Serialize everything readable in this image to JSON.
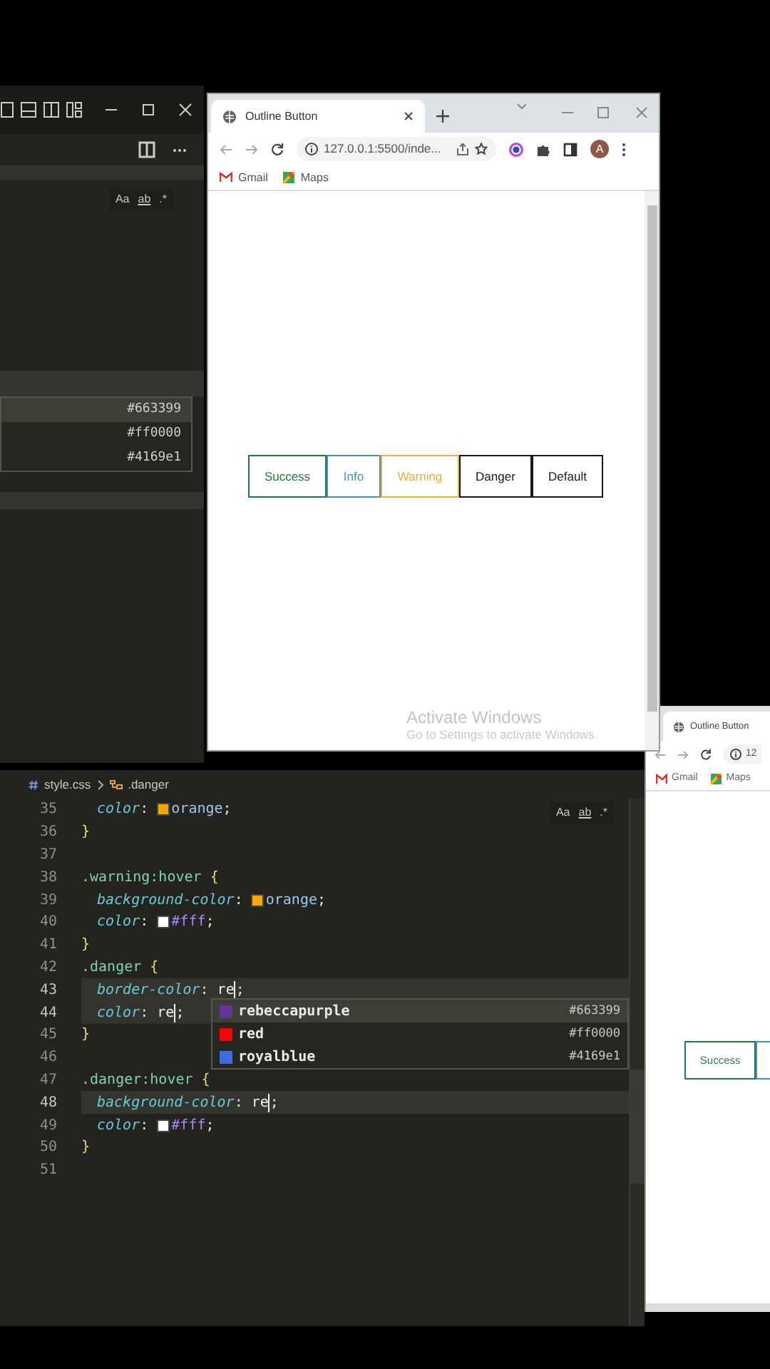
{
  "top_editor": {
    "find_toggles": [
      "Aa",
      "ab",
      ".*"
    ],
    "suggestions": [
      {
        "code": "#663399",
        "selected": true
      },
      {
        "code": "#ff0000",
        "selected": false
      },
      {
        "code": "#4169e1",
        "selected": false
      }
    ]
  },
  "browser": {
    "tab_title": "Outline Button",
    "url": "127.0.0.1:5500/inde...",
    "avatar": "A",
    "bookmarks": [
      "Gmail",
      "Maps"
    ],
    "buttons": [
      {
        "label": "Success",
        "color": "#1f7a3a"
      },
      {
        "label": "Info",
        "color": "#4a90c2"
      },
      {
        "label": "Warning",
        "color": "#f0ad3c"
      },
      {
        "label": "Danger",
        "color": "#1a1a1a"
      },
      {
        "label": "Default",
        "color": "#1a1a1a"
      }
    ],
    "activation": {
      "title": "Activate Windows",
      "subtitle": "Go to Settings to activate Windows."
    }
  },
  "editor": {
    "breadcrumb": [
      "style.css",
      ".danger"
    ],
    "find_toggles": [
      "Aa",
      "ab",
      ".*"
    ],
    "lines": [
      {
        "number": "35",
        "indented": true,
        "highlighted": false,
        "segments": [
          {
            "kind": "prop",
            "text": "color"
          },
          {
            "kind": "punct",
            "text": ": "
          },
          {
            "kind": "swatch",
            "color": "#ffa500"
          },
          {
            "kind": "value",
            "text": "orange"
          },
          {
            "kind": "punct",
            "text": ";"
          }
        ]
      },
      {
        "number": "36",
        "indented": false,
        "highlighted": false,
        "segments": [
          {
            "kind": "brace",
            "text": "}"
          }
        ]
      },
      {
        "number": "37",
        "highlighted": false
      },
      {
        "number": "38",
        "indented": false,
        "highlighted": false,
        "segments": [
          {
            "kind": "selector",
            "text": ".warning:hover"
          },
          {
            "kind": "brace",
            "text": " {"
          }
        ]
      },
      {
        "number": "39",
        "indented": true,
        "highlighted": false,
        "segments": [
          {
            "kind": "prop",
            "text": "background-color"
          },
          {
            "kind": "punct",
            "text": ": "
          },
          {
            "kind": "swatch",
            "color": "#ffa500"
          },
          {
            "kind": "value",
            "text": "orange"
          },
          {
            "kind": "punct",
            "text": ";"
          }
        ]
      },
      {
        "number": "40",
        "indented": true,
        "highlighted": false,
        "segments": [
          {
            "kind": "prop",
            "text": "color"
          },
          {
            "kind": "punct",
            "text": ": "
          },
          {
            "kind": "swatch",
            "color": "#ffffff"
          },
          {
            "kind": "hex",
            "text": "#fff"
          },
          {
            "kind": "punct",
            "text": ";"
          }
        ]
      },
      {
        "number": "41",
        "indented": false,
        "highlighted": false,
        "segments": [
          {
            "kind": "brace",
            "text": "}"
          }
        ]
      },
      {
        "number": "42",
        "indented": false,
        "highlighted": false,
        "segments": [
          {
            "kind": "selector",
            "text": ".danger"
          },
          {
            "kind": "brace",
            "text": " {"
          }
        ]
      },
      {
        "number": "43",
        "indented": true,
        "highlighted": true,
        "segments": [
          {
            "kind": "prop",
            "text": "border-color"
          },
          {
            "kind": "punct",
            "text": ": "
          },
          {
            "kind": "plain",
            "text": "re"
          },
          {
            "kind": "cursor"
          },
          {
            "kind": "punct",
            "text": ";"
          }
        ]
      },
      {
        "number": "44",
        "indented": true,
        "highlighted": true,
        "segments": [
          {
            "kind": "prop",
            "text": "color"
          },
          {
            "kind": "punct",
            "text": ": "
          },
          {
            "kind": "plain",
            "text": "re"
          },
          {
            "kind": "cursor"
          },
          {
            "kind": "punct",
            "text": ";"
          }
        ]
      },
      {
        "number": "45",
        "indented": false,
        "highlighted": false,
        "segments": [
          {
            "kind": "brace",
            "text": "}"
          }
        ]
      },
      {
        "number": "46",
        "highlighted": false
      },
      {
        "number": "47",
        "indented": false,
        "highlighted": false,
        "segments": [
          {
            "kind": "selector",
            "text": ".danger:hover"
          },
          {
            "kind": "brace",
            "text": " {"
          }
        ]
      },
      {
        "number": "48",
        "indented": true,
        "highlighted": true,
        "segments": [
          {
            "kind": "prop",
            "text": "background-color"
          },
          {
            "kind": "punct",
            "text": ": "
          },
          {
            "kind": "plain",
            "text": "re"
          },
          {
            "kind": "cursor"
          },
          {
            "kind": "punct",
            "text": ";"
          }
        ]
      },
      {
        "number": "49",
        "indented": true,
        "highlighted": false,
        "segments": [
          {
            "kind": "prop",
            "text": "color"
          },
          {
            "kind": "punct",
            "text": ": "
          },
          {
            "kind": "swatch",
            "color": "#ffffff"
          },
          {
            "kind": "hex",
            "text": "#fff"
          },
          {
            "kind": "punct",
            "text": ";"
          }
        ]
      },
      {
        "number": "50",
        "indented": false,
        "highlighted": false,
        "segments": [
          {
            "kind": "brace",
            "text": "}"
          }
        ]
      },
      {
        "number": "51",
        "highlighted": false
      }
    ],
    "suggestions": [
      {
        "label": "rebeccapurple",
        "code": "#663399",
        "color": "#663399",
        "selected": true
      },
      {
        "label": "red",
        "code": "#ff0000",
        "color": "#ff0000",
        "selected": false
      },
      {
        "label": "royalblue",
        "code": "#4169e1",
        "color": "#4169e1",
        "selected": false
      }
    ]
  },
  "side_browser": {
    "tab_title": "Outline Button",
    "url": "12",
    "bookmarks": [
      "Gmail",
      "Maps"
    ],
    "button": "Success"
  }
}
